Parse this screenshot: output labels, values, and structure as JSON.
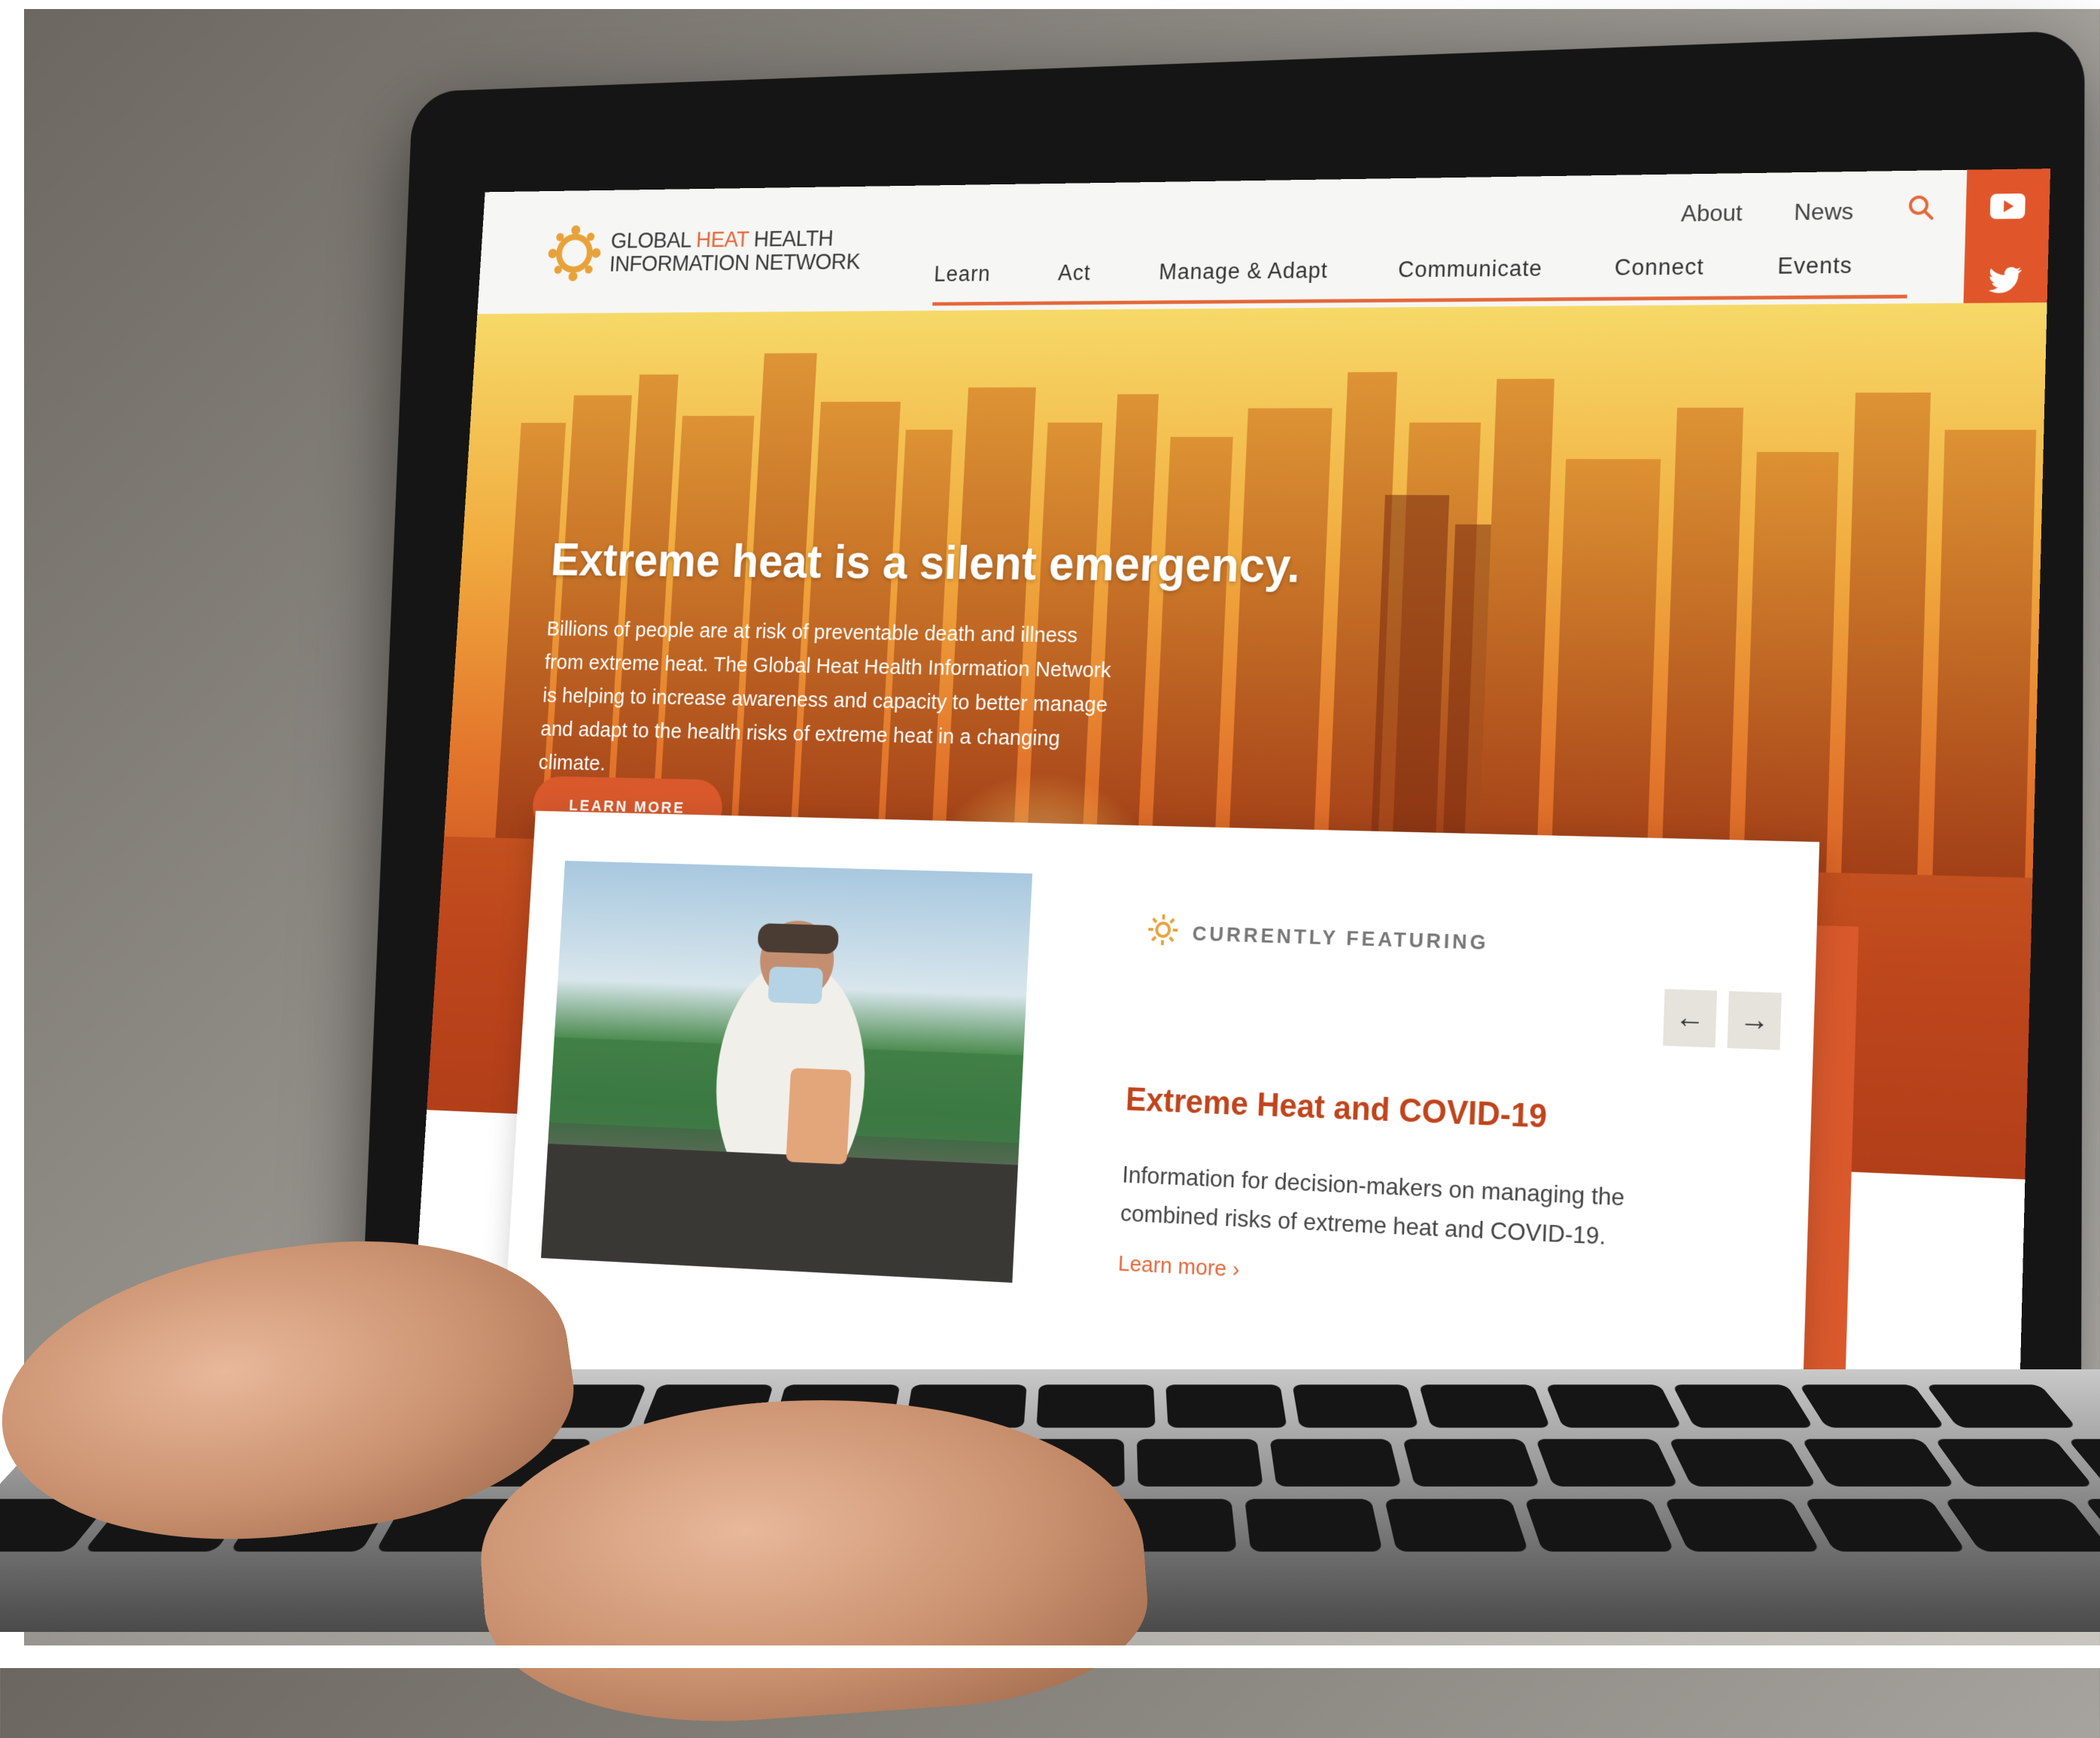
{
  "brand": {
    "line1_a": "GLOBAL ",
    "line1_b": "HEAT",
    "line1_c": " HEALTH",
    "line2": "INFORMATION NETWORK",
    "accent_color": "#e4673a"
  },
  "utility_nav": {
    "items": [
      "About",
      "News"
    ],
    "search_icon": "search-icon"
  },
  "main_nav": {
    "items": [
      "Learn",
      "Act",
      "Manage & Adapt",
      "Communicate",
      "Connect",
      "Events"
    ]
  },
  "social": {
    "youtube_icon": "youtube-icon",
    "twitter_icon": "twitter-icon"
  },
  "hero": {
    "title": "Extreme heat is a silent emergency.",
    "body": "Billions of people are at risk of preventable death and illness from extreme heat. The Global Heat Health Information Network is helping to increase awareness and capacity to better manage and adapt to the health risks of extreme heat in a changing climate.",
    "button_label": "LEARN MORE"
  },
  "feature": {
    "label": "CURRENTLY FEATURING",
    "title": "Extreme Heat and COVID-19",
    "description": "Information for decision-makers on managing the combined risks of extreme heat and COVID-19.",
    "link_label": "Learn more",
    "prev_icon": "arrow-left-icon",
    "next_icon": "arrow-right-icon"
  }
}
